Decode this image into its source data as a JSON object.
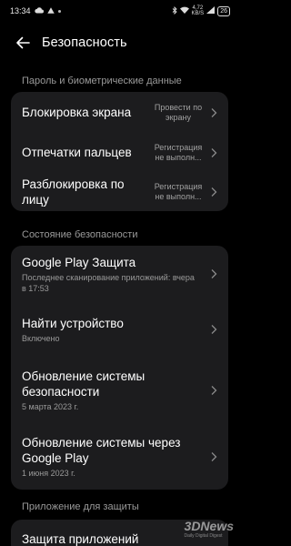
{
  "status_bar": {
    "time": "13:34",
    "net_speed": "4,72\nKB/S",
    "battery": "26"
  },
  "header": {
    "title": "Безопасность"
  },
  "sections": [
    {
      "header": "Пароль и биометрические данные",
      "items": [
        {
          "title": "Блокировка экрана",
          "value": "Провести по экрану"
        },
        {
          "title": "Отпечатки пальцев",
          "value": "Регистрация не выполн..."
        },
        {
          "title": "Разблокировка по лицу",
          "value": "Регистрация не выполн..."
        }
      ]
    },
    {
      "header": "Состояние безопасности",
      "items": [
        {
          "title": "Google Play Защита",
          "subtitle": "Последнее сканирование приложений: вчера в 17:53"
        },
        {
          "title": "Найти устройство",
          "subtitle": "Включено"
        },
        {
          "title": "Обновление системы безопасности",
          "subtitle": "5 марта 2023 г."
        },
        {
          "title": "Обновление системы через Google Play",
          "subtitle": "1 июня 2023 г."
        }
      ]
    },
    {
      "header": "Приложение для защиты",
      "items": [
        {
          "title": "Защита приложений"
        }
      ]
    }
  ],
  "watermark": {
    "logo": "3DNews",
    "tagline": "Daily Digital Digest"
  }
}
